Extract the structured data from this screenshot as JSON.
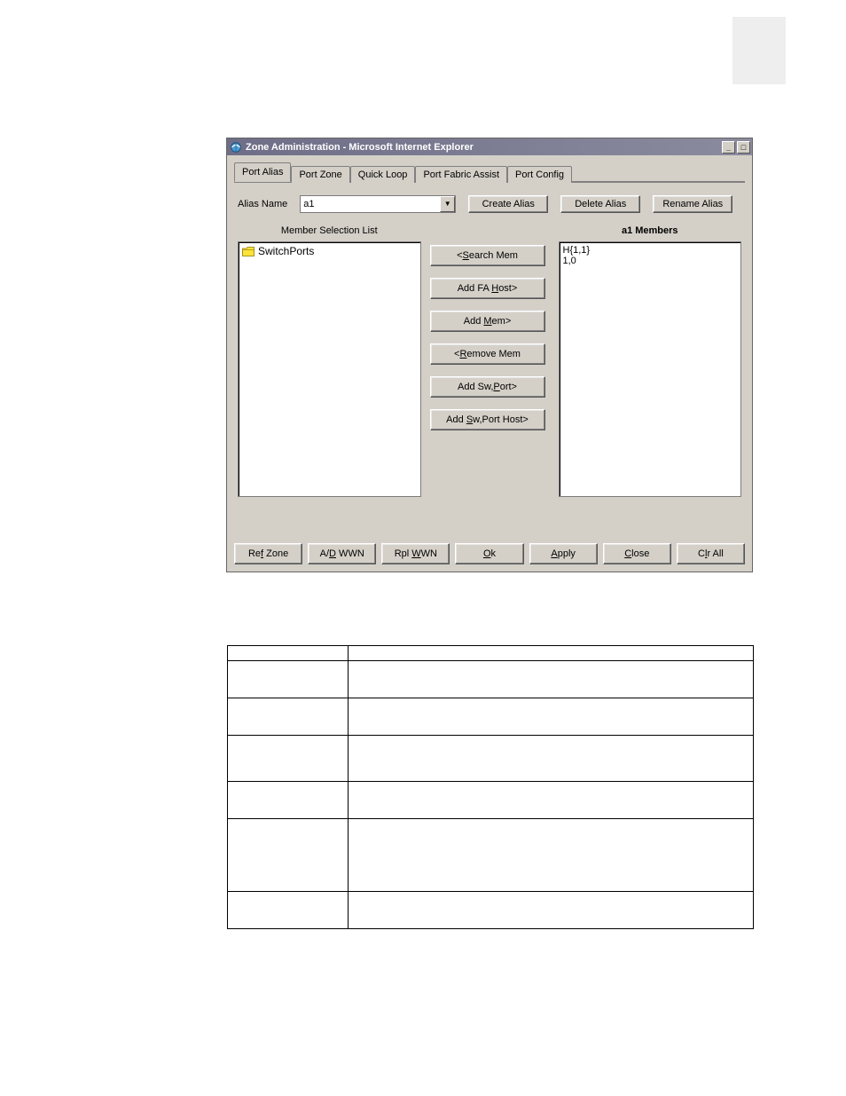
{
  "window": {
    "title": "Zone Administration - Microsoft Internet Explorer",
    "min_symbol": "_",
    "max_symbol": "□"
  },
  "tabs": {
    "port_alias": "Port Alias",
    "port_zone": "Port Zone",
    "quick_loop": "Quick Loop",
    "port_fabric_assist": "Port Fabric Assist",
    "port_config": "Port Config"
  },
  "alias_row": {
    "label": "Alias Name",
    "value": "a1",
    "create": "Create Alias",
    "delete": "Delete Alias",
    "rename": "Rename Alias"
  },
  "lists": {
    "left_header": "Member Selection List",
    "right_header": "a1 Members",
    "left_item": "SwitchPorts",
    "right_items": [
      "H{1,1}",
      "1,0"
    ]
  },
  "mid_buttons": {
    "search_pre": "<",
    "search": "earch Mem",
    "fa_pre": "Add FA ",
    "fa_u": "H",
    "fa_post": "ost>",
    "addmem_pre": "Add ",
    "addmem_u": "M",
    "addmem_post": "em>",
    "remove_pre": "<",
    "remove_u": "R",
    "remove_post": "emove Mem",
    "swport_pre": "Add Sw,",
    "swport_u": "P",
    "swport_post": "ort>",
    "swporthost_pre": "Add ",
    "swporthost_u": "S",
    "swporthost_post": "w,Port Host>"
  },
  "bottom": {
    "refzone_pre": "Re",
    "refzone_u": "f",
    "refzone_post": " Zone",
    "adwwn_pre": "A/",
    "adwwn_u": "D",
    "adwwn_post": " WWN",
    "rplwwn_pre": "Rpl ",
    "rplwwn_u": "W",
    "rplwwn_post": "WN",
    "ok_u": "O",
    "ok_post": "k",
    "apply_u": "A",
    "apply_post": "pply",
    "close_u": "C",
    "close_post": "lose",
    "clrall_pre": "C",
    "clrall_u": "l",
    "clrall_post": "r All"
  },
  "table": {
    "h1": "",
    "h2": "",
    "rows": [
      {
        "c1": "",
        "c2": ""
      },
      {
        "c1": "",
        "c2": ""
      },
      {
        "c1": "",
        "c2": ""
      },
      {
        "c1": "",
        "c2": ""
      },
      {
        "c1": "",
        "c2": ""
      },
      {
        "c1": "",
        "c2": ""
      }
    ]
  }
}
